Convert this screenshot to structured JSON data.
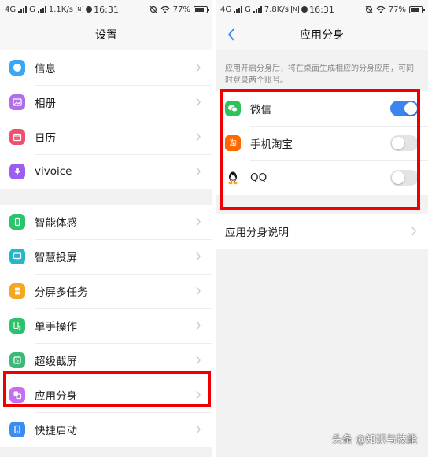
{
  "left_screen": {
    "status": {
      "network": "4G",
      "carrier": "G",
      "speed": "1.1K/s",
      "time": "16:31",
      "battery": "77%",
      "battery_level": 0.77
    },
    "title": "设置",
    "groups": [
      [
        {
          "label": "信息",
          "icon": "message-icon",
          "color": "#3aa7f5"
        },
        {
          "label": "相册",
          "icon": "album-icon",
          "color": "#b06ee8"
        },
        {
          "label": "日历",
          "icon": "calendar-icon",
          "color": "#f0506e"
        },
        {
          "label": "vivoice",
          "icon": "microphone-icon",
          "color": "#9b5ef0"
        }
      ],
      [
        {
          "label": "智能体感",
          "icon": "motion-icon",
          "color": "#29c46b"
        },
        {
          "label": "智慧投屏",
          "icon": "screencast-icon",
          "color": "#25b6c9"
        },
        {
          "label": "分屏多任务",
          "icon": "split-screen-icon",
          "color": "#f5a623"
        },
        {
          "label": "单手操作",
          "icon": "one-hand-icon",
          "color": "#2bc36a"
        },
        {
          "label": "超级截屏",
          "icon": "screenshot-icon",
          "color": "#3cb878"
        },
        {
          "label": "应用分身",
          "icon": "app-clone-icon",
          "color": "#c56ef0"
        },
        {
          "label": "快捷启动",
          "icon": "quick-launch-icon",
          "color": "#3a8cf0"
        }
      ]
    ]
  },
  "right_screen": {
    "status": {
      "network": "4G",
      "carrier": "G",
      "speed": "7.8K/s",
      "time": "16:31",
      "battery": "77%",
      "battery_level": 0.77
    },
    "title": "应用分身",
    "description": "应用开启分身后，将在桌面生成相应的分身应用，可同时登录两个账号。",
    "apps": [
      {
        "name": "微信",
        "icon": "wechat-icon",
        "enabled": true
      },
      {
        "name": "手机淘宝",
        "icon": "taobao-icon",
        "enabled": false
      },
      {
        "name": "QQ",
        "icon": "qq-icon",
        "enabled": false
      }
    ],
    "info_link": "应用分身说明"
  },
  "watermark": "头条 @知识与技能",
  "colors": {
    "highlight": "#ee0000",
    "toggle_on": "#3a85f0",
    "toggle_off": "#e4e4e4",
    "accent": "#3a85f0"
  }
}
